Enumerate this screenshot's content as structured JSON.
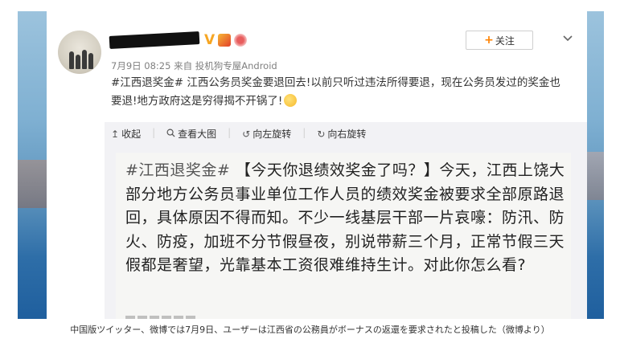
{
  "post": {
    "meta": "7月9日 08:25 来自 投机狗专屋Android",
    "hashtag": "#江西退奖金#",
    "text": " 江西公务员奖金要退回去!以前只听过违法所得要退，现在公务员发过的奖金也要退!地方政府这是穷得揭不开锅了!",
    "badge_v": "V",
    "follow_label": "关注",
    "follow_plus": "+",
    "chevron_icon": "chevron-down-icon"
  },
  "toolbar": {
    "collapse": "收起",
    "view_large": "查看大图",
    "rotate_left": "向左旋转",
    "rotate_right": "向右旋转"
  },
  "image": {
    "tag": "#江西退奖金#",
    "body": " 【今天你退绩效奖金了吗？】今天，江西上饶大部分地方公务员事业单位工作人员的绩效奖金被要求全部原路退回，具体原因不得而知。不少一线基层干部一片哀嚎：防汛、防火、防疫，加班不分节假昼夜，别说带薪三个月，正常节假三天假都是奢望，光靠基本工资很难维持生计。对此你怎么看?"
  },
  "caption": "中国版ツイッター、微博では7月9日、ユーザーは江西省の公務員がボーナスの返還を要求されたと投稿した（微博より）",
  "colors": {
    "accent_orange": "#ff8200",
    "badge_v": "#f6a623",
    "text": "#333333",
    "meta": "#808080"
  }
}
